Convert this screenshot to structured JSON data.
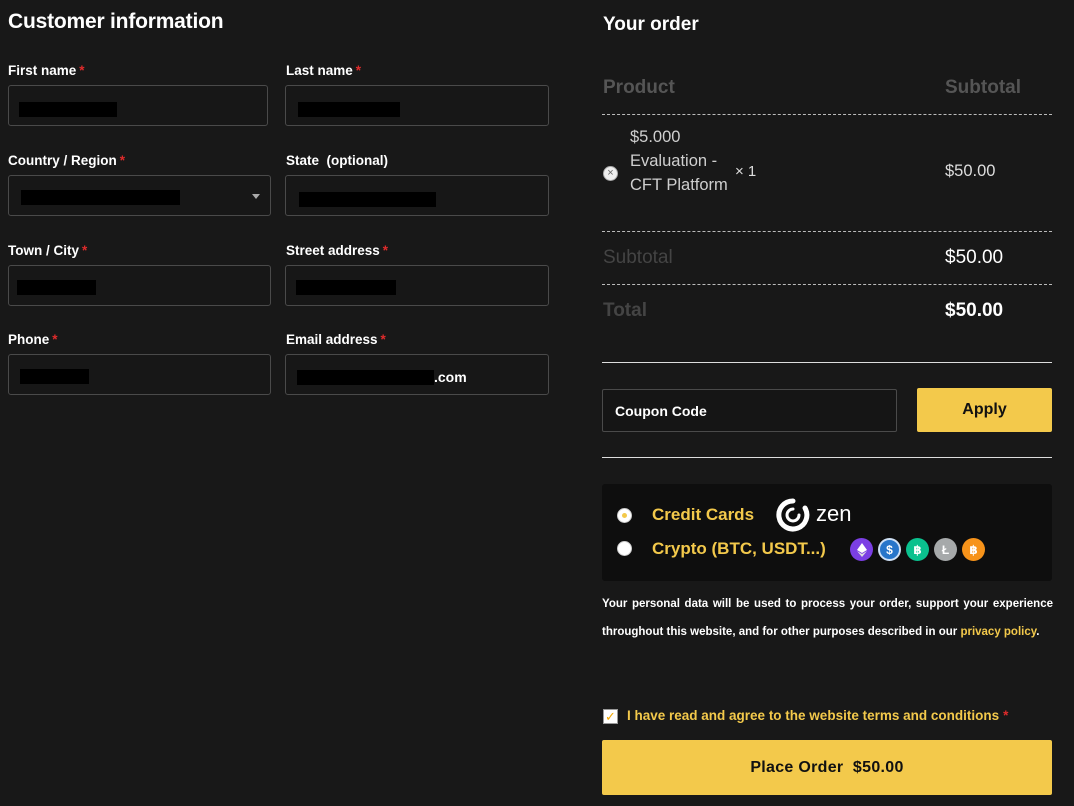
{
  "customer": {
    "title": "Customer information",
    "required_mark": "*",
    "fields": {
      "first_name": {
        "label": "First name",
        "value": ""
      },
      "last_name": {
        "label": "Last name",
        "value": ""
      },
      "country": {
        "label": "Country / Region",
        "value": ""
      },
      "state": {
        "label": "State  (optional)",
        "value": ""
      },
      "town": {
        "label": "Town / City",
        "value": ""
      },
      "street": {
        "label": "Street address",
        "value": ""
      },
      "phone": {
        "label": "Phone",
        "value": ""
      },
      "email": {
        "label": "Email address",
        "value_visible": ".com"
      }
    }
  },
  "order": {
    "title": "Your order",
    "col_product": "Product",
    "col_subtotal": "Subtotal",
    "item": {
      "name": "$5.000 Evaluation - CFT Platform",
      "qty": "× 1",
      "subtotal": "$50.00",
      "remove_icon": "remove-circle-icon"
    },
    "subtotal_label": "Subtotal",
    "subtotal_value": "$50.00",
    "total_label": "Total",
    "total_value": "$50.00"
  },
  "coupon": {
    "placeholder": "Coupon Code",
    "apply_label": "Apply"
  },
  "payment": {
    "options": [
      {
        "label": "Credit Cards",
        "brand": "zen",
        "selected": true
      },
      {
        "label": "Crypto (BTC, USDT...)",
        "selected": false,
        "coins": [
          "ethereum-icon",
          "usdc-icon",
          "bitcoin-cash-icon",
          "litecoin-icon",
          "bitcoin-icon"
        ]
      }
    ]
  },
  "policy": {
    "text": "Your personal data will be used to process your order, support your experience throughout this website, and for other purposes described in our ",
    "link": "privacy policy",
    "end": "."
  },
  "terms": {
    "label": "I have read and agree to the website terms and conditions",
    "checked": true
  },
  "place_order": {
    "label": "Place Order  $50.00"
  },
  "colors": {
    "background": "#181818",
    "accent": "#f3c94b",
    "required": "#e02b2b"
  }
}
